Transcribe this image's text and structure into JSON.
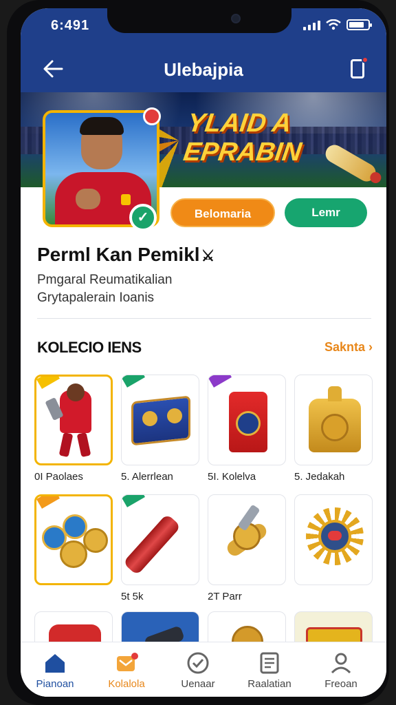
{
  "status": {
    "time": "6:491"
  },
  "header": {
    "title": "Ulebajpia"
  },
  "banner": {
    "line1": "YLAID A",
    "line2": "EPRABIN"
  },
  "actions": {
    "primary_label": "Belomaria",
    "secondary_label": "Lemr"
  },
  "profile": {
    "name": "Perml Kan Pemikl",
    "sub1": "Pmgaral Reumatikalian",
    "sub2": "Grytapalerain Ioanis"
  },
  "section": {
    "title": "KOLECIO IENS",
    "see_all": "Saknta"
  },
  "items": [
    {
      "label": "0I Paolaes",
      "tag": "y"
    },
    {
      "label": "5. Alerrlean",
      "tag": "g"
    },
    {
      "label": "5I. Kolelva",
      "tag": "p"
    },
    {
      "label": "5. Jedakah",
      "tag": ""
    },
    {
      "label": "",
      "tag": "o"
    },
    {
      "label": "5t 5k",
      "tag": "g"
    },
    {
      "label": "2T Parr",
      "tag": ""
    },
    {
      "label": "",
      "tag": ""
    }
  ],
  "tabs": [
    {
      "label": "Pianoan",
      "icon": "home-icon"
    },
    {
      "label": "Kolalola",
      "icon": "collection-icon"
    },
    {
      "label": "Uenaar",
      "icon": "check-icon"
    },
    {
      "label": "Raalatian",
      "icon": "list-icon"
    },
    {
      "label": "Freoan",
      "icon": "profile-icon"
    }
  ],
  "colors": {
    "brand": "#1f3f8a",
    "accent": "#f08a16",
    "success": "#17a56f",
    "selection": "#f3b400"
  }
}
